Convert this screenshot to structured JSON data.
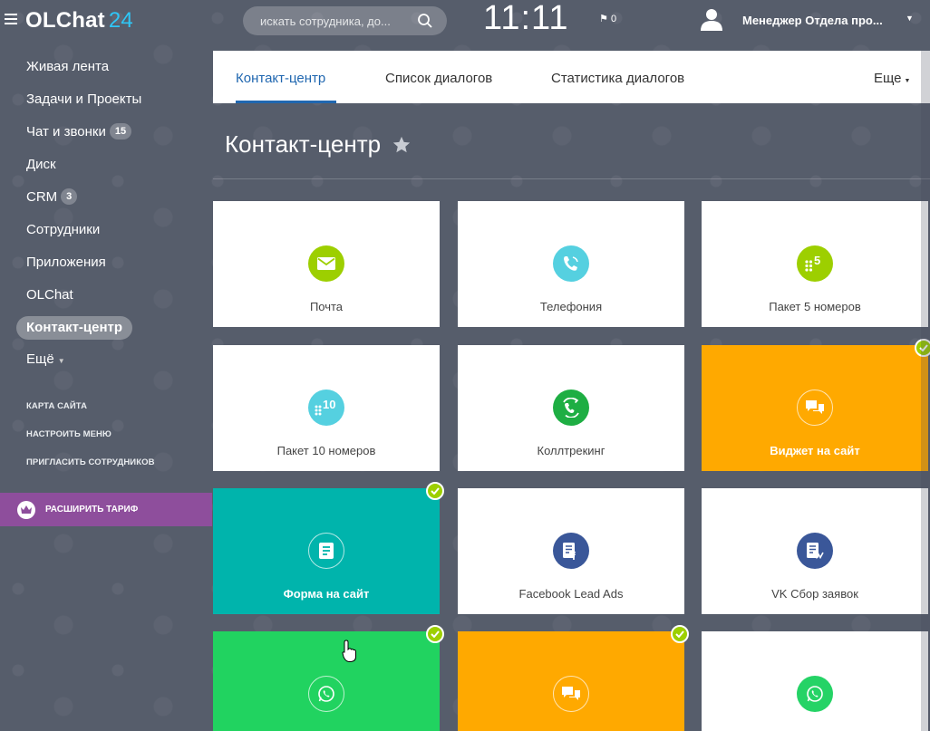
{
  "header": {
    "logo_name": "OLChat",
    "logo_num": "24",
    "search_placeholder": "искать сотрудника, до...",
    "clock": "11:11",
    "flag_count": "0",
    "user_name": "Менеджер Отдела про..."
  },
  "sidebar": {
    "items": [
      {
        "label": "Живая лента"
      },
      {
        "label": "Задачи и Проекты"
      },
      {
        "label": "Чат и звонки",
        "counter": "15"
      },
      {
        "label": "Диск"
      },
      {
        "label": "CRM",
        "counter": "3"
      },
      {
        "label": "Сотрудники"
      },
      {
        "label": "Приложения"
      },
      {
        "label": "OLChat"
      },
      {
        "label": "Контакт-центр",
        "active": true
      },
      {
        "label": "Ещё"
      }
    ],
    "small_links": [
      "КАРТА САЙТА",
      "НАСТРОИТЬ МЕНЮ",
      "ПРИГЛАСИТЬ СОТРУДНИКОВ"
    ],
    "upgrade_label": "РАСШИРИТЬ ТАРИФ"
  },
  "tabs": [
    "Контакт-центр",
    "Список диалогов",
    "Статистика диалогов",
    "Еще"
  ],
  "page_title": "Контакт-центр",
  "tiles": [
    {
      "label": "Почта",
      "icon": "mail-icon",
      "color": "#9dcf00"
    },
    {
      "label": "Телефония",
      "icon": "phone-icon",
      "color": "#55d0e0"
    },
    {
      "label": "Пакет 5 номеров",
      "icon": "dialpad-5-icon",
      "color": "#9dcf00"
    },
    {
      "label": "Пакет 10 номеров",
      "icon": "dialpad-10-icon",
      "color": "#55d0e0"
    },
    {
      "label": "Коллтрекинг",
      "icon": "calltracking-icon",
      "color": "#1eae43"
    },
    {
      "label": "Виджет на сайт",
      "icon": "chat-icon",
      "color": "#ffa900",
      "checked": true
    },
    {
      "label": "Форма на сайт",
      "icon": "form-icon",
      "color": "#00b4ac",
      "checked": true
    },
    {
      "label": "Facebook Lead Ads",
      "icon": "facebook-form-icon",
      "color": "#3a5799"
    },
    {
      "label": "VK Сбор заявок",
      "icon": "vk-form-icon",
      "color": "#3a5799"
    },
    {
      "label": "",
      "icon": "whatsapp-icon",
      "color": "#25d366",
      "checked": true
    },
    {
      "label": "",
      "icon": "chat-icon",
      "color": "#ffa900",
      "checked": true
    },
    {
      "label": "",
      "icon": "whatsapp-icon",
      "color": "#25d366"
    }
  ]
}
